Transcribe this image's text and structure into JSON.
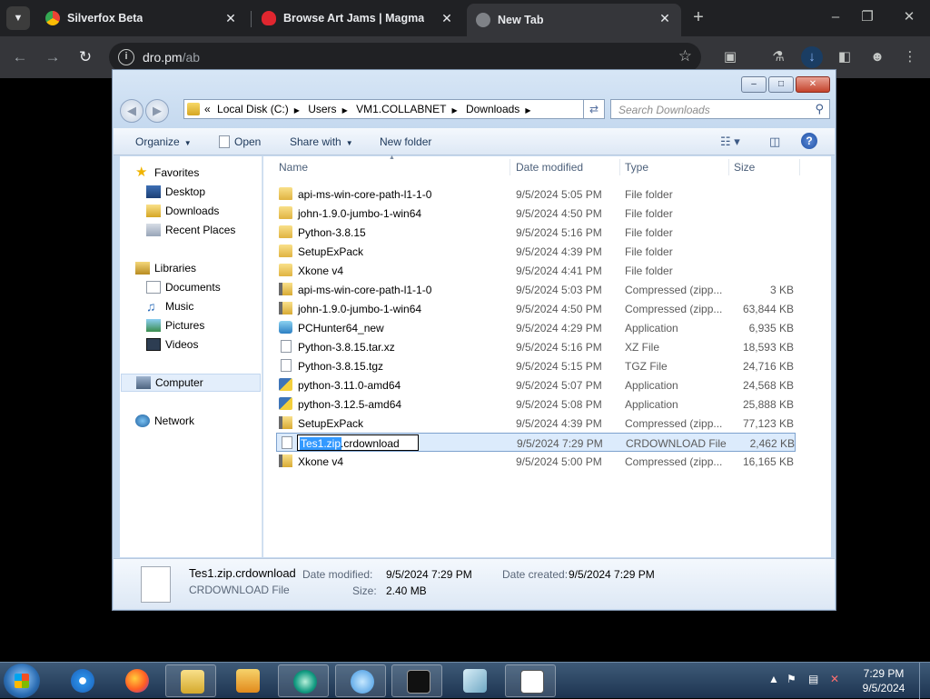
{
  "browser": {
    "tabs": [
      {
        "title": "Silverfox Beta",
        "favicon_color": "#e8453c"
      },
      {
        "title": "Browse Art Jams | Magma",
        "favicon_color": "#e0262f"
      },
      {
        "title": "New Tab",
        "favicon_color": "#7f8287"
      }
    ],
    "url_host": "dro.pm",
    "url_path": "/ab"
  },
  "explorer": {
    "breadcrumbs": [
      "Local Disk (C:)",
      "Users",
      "VM1.COLLABNET",
      "Downloads"
    ],
    "search_placeholder": "Search Downloads",
    "commands": {
      "organize": "Organize",
      "open": "Open",
      "share_with": "Share with",
      "new_folder": "New folder"
    },
    "nav": {
      "favorites": "Favorites",
      "desktop": "Desktop",
      "downloads": "Downloads",
      "recent_places": "Recent Places",
      "libraries": "Libraries",
      "documents": "Documents",
      "music": "Music",
      "pictures": "Pictures",
      "videos": "Videos",
      "computer": "Computer",
      "network": "Network"
    },
    "columns": {
      "name": "Name",
      "date": "Date modified",
      "type": "Type",
      "size": "Size"
    },
    "files": [
      {
        "name": "api-ms-win-core-path-l1-1-0",
        "date": "9/5/2024 5:05 PM",
        "type": "File folder",
        "size": "",
        "icon": "folder"
      },
      {
        "name": "john-1.9.0-jumbo-1-win64",
        "date": "9/5/2024 4:50 PM",
        "type": "File folder",
        "size": "",
        "icon": "folder"
      },
      {
        "name": "Python-3.8.15",
        "date": "9/5/2024 5:16 PM",
        "type": "File folder",
        "size": "",
        "icon": "folder"
      },
      {
        "name": "SetupExPack",
        "date": "9/5/2024 4:39 PM",
        "type": "File folder",
        "size": "",
        "icon": "folder"
      },
      {
        "name": "Xkone v4",
        "date": "9/5/2024 4:41 PM",
        "type": "File folder",
        "size": "",
        "icon": "folder"
      },
      {
        "name": "api-ms-win-core-path-l1-1-0",
        "date": "9/5/2024 5:03 PM",
        "type": "Compressed (zipp...",
        "size": "3 KB",
        "icon": "zip"
      },
      {
        "name": "john-1.9.0-jumbo-1-win64",
        "date": "9/5/2024 4:50 PM",
        "type": "Compressed (zipp...",
        "size": "63,844 KB",
        "icon": "zip"
      },
      {
        "name": "PCHunter64_new",
        "date": "9/5/2024 4:29 PM",
        "type": "Application",
        "size": "6,935 KB",
        "icon": "app"
      },
      {
        "name": "Python-3.8.15.tar.xz",
        "date": "9/5/2024 5:16 PM",
        "type": "XZ File",
        "size": "18,593 KB",
        "icon": "doc"
      },
      {
        "name": "Python-3.8.15.tgz",
        "date": "9/5/2024 5:15 PM",
        "type": "TGZ File",
        "size": "24,716 KB",
        "icon": "doc"
      },
      {
        "name": "python-3.11.0-amd64",
        "date": "9/5/2024 5:07 PM",
        "type": "Application",
        "size": "24,568 KB",
        "icon": "py"
      },
      {
        "name": "python-3.12.5-amd64",
        "date": "9/5/2024 5:08 PM",
        "type": "Application",
        "size": "25,888 KB",
        "icon": "py"
      },
      {
        "name": "SetupExPack",
        "date": "9/5/2024 4:39 PM",
        "type": "Compressed (zipp...",
        "size": "77,123 KB",
        "icon": "zip"
      },
      {
        "name": "Tes1.zip.crdownload",
        "date": "9/5/2024 7:29 PM",
        "type": "CRDOWNLOAD File",
        "size": "2,462 KB",
        "icon": "doc"
      },
      {
        "name": "Xkone v4",
        "date": "9/5/2024 5:00 PM",
        "type": "Compressed (zipp...",
        "size": "16,165 KB",
        "icon": "zip"
      }
    ],
    "rename": {
      "selected": "Tes1.zip",
      "rest": ".crdownload"
    },
    "details": {
      "filename": "Tes1.zip.crdownload",
      "filetype": "CRDOWNLOAD File",
      "date_modified_label": "Date modified:",
      "date_modified": "9/5/2024 7:29 PM",
      "date_created_label": "Date created:",
      "date_created": "9/5/2024 7:29 PM",
      "size_label": "Size:",
      "size": "2.40 MB"
    }
  },
  "taskbar": {
    "time": "7:29 PM",
    "date": "9/5/2024"
  }
}
